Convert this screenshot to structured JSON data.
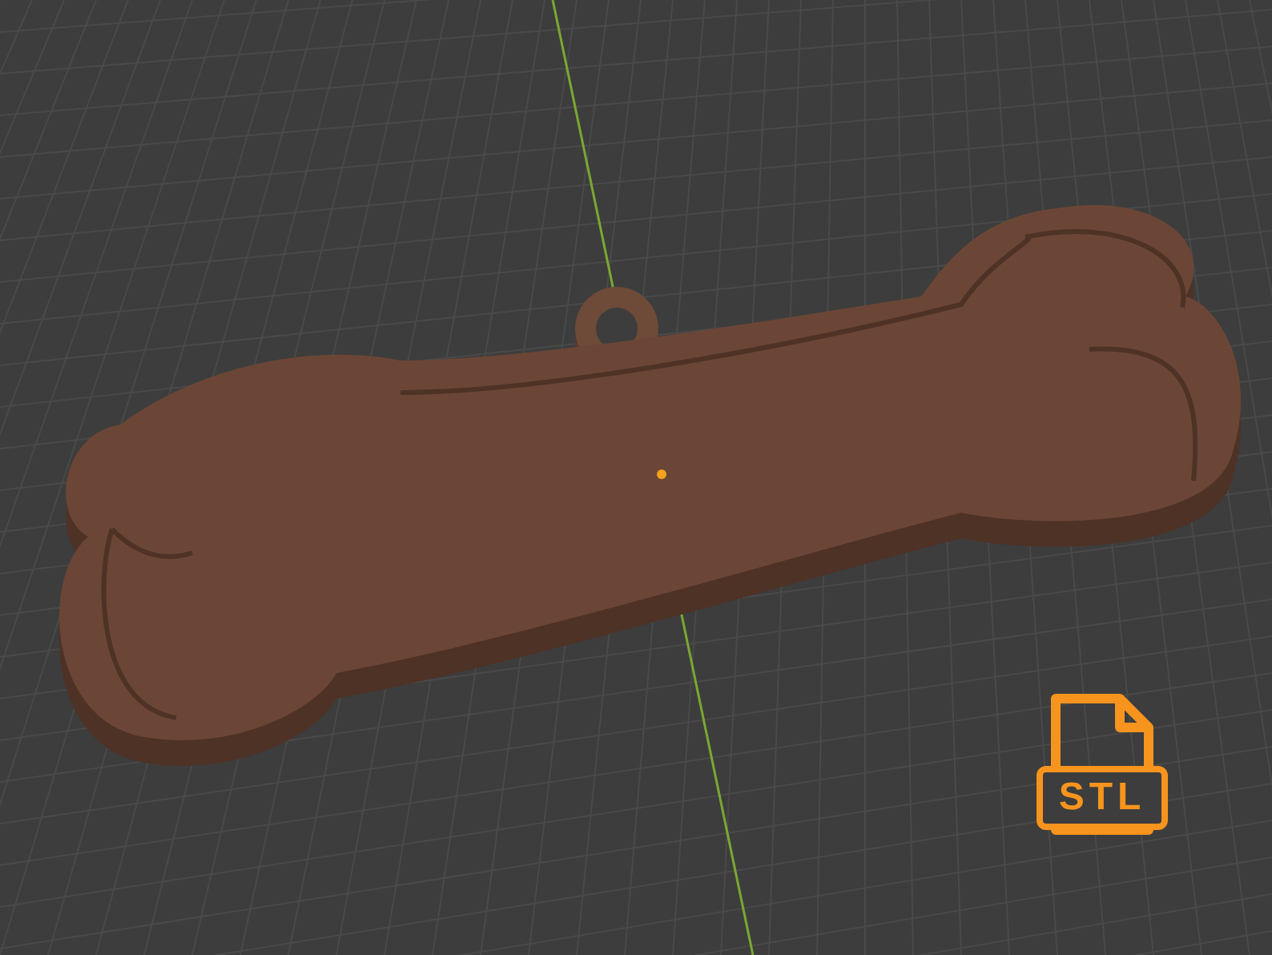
{
  "viewport": {
    "badge": {
      "label": "STL"
    }
  }
}
